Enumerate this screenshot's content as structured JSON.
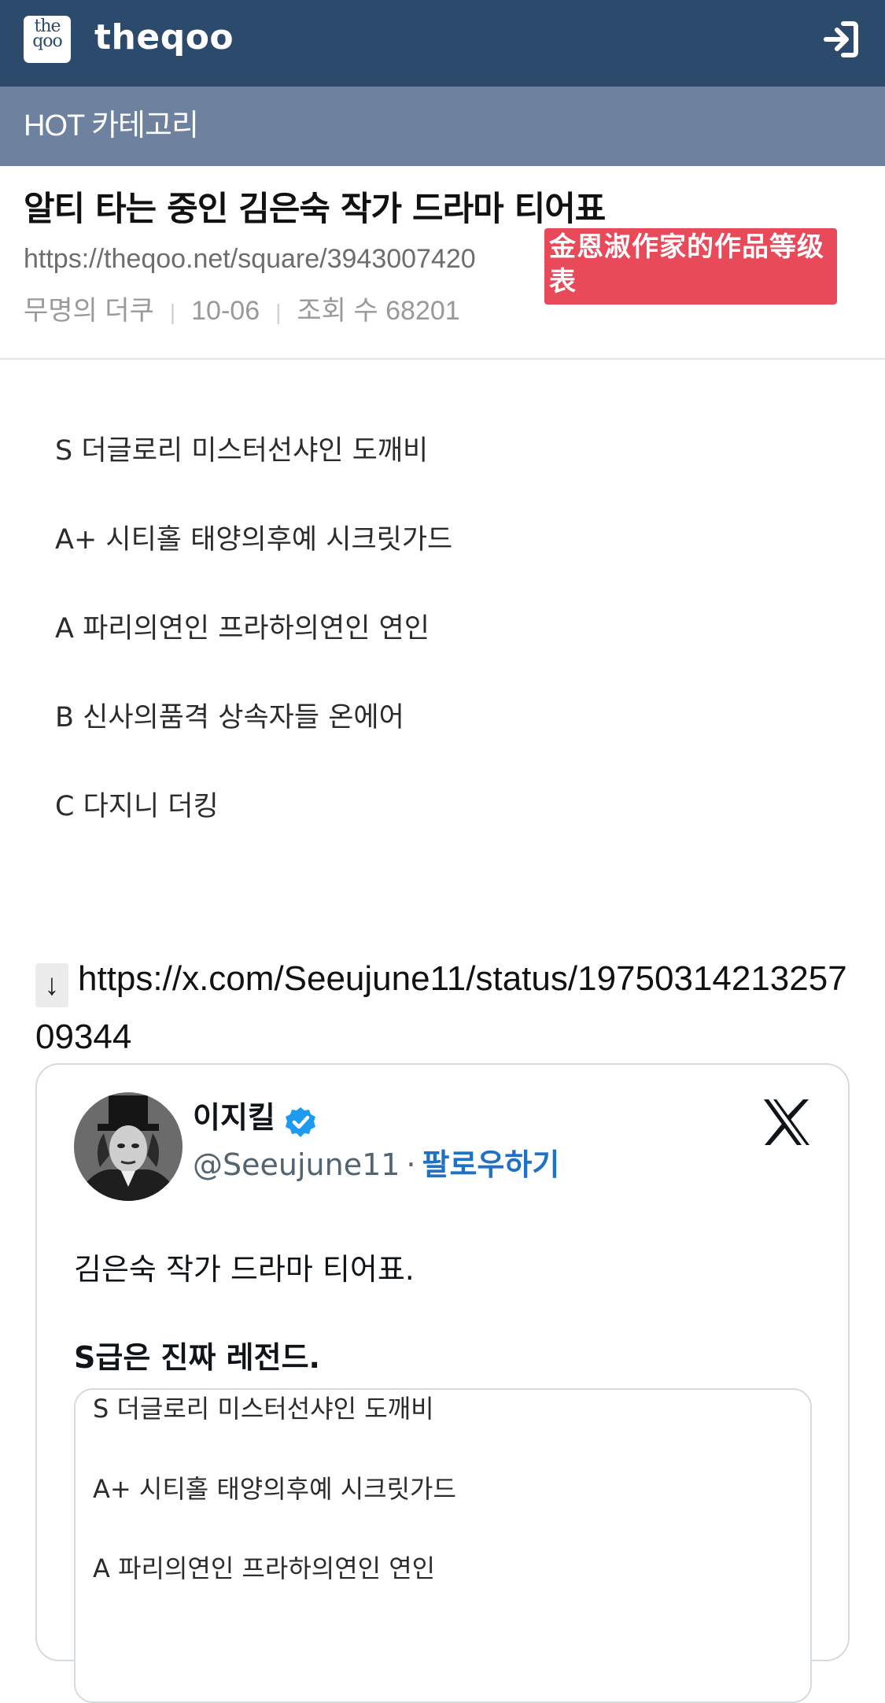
{
  "header": {
    "logo_text": "the qoo",
    "brand": "theqoo",
    "login_icon": "sign-in-icon"
  },
  "category": {
    "label": "HOT 카테고리"
  },
  "post": {
    "title": "알티 타는 중인 김은숙 작가 드라마 티어표",
    "url": "https://theqoo.net/square/3943007420",
    "translation": "金恩淑作家的作品等级表",
    "author": "무명의 더쿠",
    "date": "10-06",
    "views": "조회 수 68201"
  },
  "tiers": [
    {
      "text": "S 더글로리 미스터선샤인 도깨비"
    },
    {
      "text": "A+ 시티홀 태양의후예 시크릿가드"
    },
    {
      "text": "A 파리의연인 프라하의연인 연인"
    },
    {
      "text": "B 신사의품격 상속자들 온에어"
    },
    {
      "text": "C 다지니 더킹"
    }
  ],
  "link": {
    "arrow": "↓",
    "url": "https://x.com/Seeujune11/status/1975031421325709344"
  },
  "tweet": {
    "name": "이지킬",
    "handle": "@Seeujune11",
    "separator": "·",
    "follow": "팔로우하기",
    "line1": "김은숙 작가 드라마 티어표.",
    "line2": "S급은 진짜 레전드.",
    "image_rows": [
      {
        "text": "S 더글로리 미스터선샤인 도깨비"
      },
      {
        "text": "A+ 시티홀 태양의후예 시크릿가드"
      },
      {
        "text": "A 파리의연인 프라하의연인 연인"
      }
    ]
  },
  "colors": {
    "topbar": "#2c4a6c",
    "category_bar": "#6e819e",
    "badge": "#e84a5a",
    "follow": "#1d72c7"
  }
}
